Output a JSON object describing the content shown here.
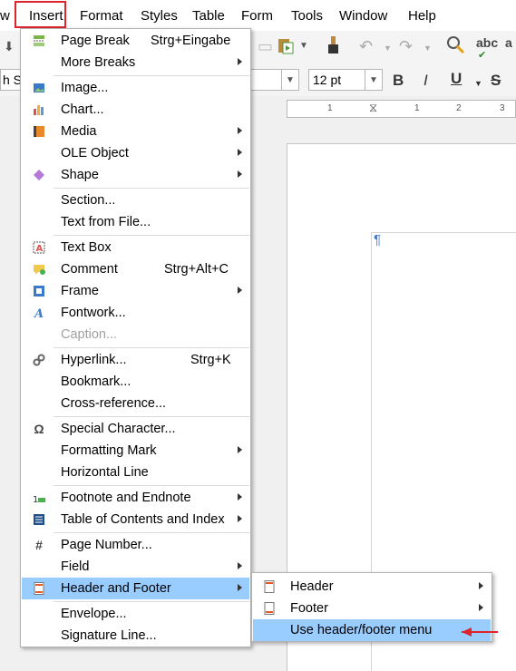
{
  "menubar": {
    "items": [
      "w",
      "Insert",
      "Format",
      "Styles",
      "Table",
      "Form",
      "Tools",
      "Window",
      "Help"
    ]
  },
  "toolbar": {
    "font_name_value": "h St",
    "font_size_value": "12 pt",
    "bold": "B",
    "italic": "I",
    "underline": "U",
    "strikethrough": "S",
    "spellcheck_label": "abc"
  },
  "ruler": {
    "ticks": [
      "1",
      "1",
      "2",
      "3"
    ]
  },
  "page": {
    "pilcrow": "¶"
  },
  "insert_menu": {
    "items": [
      {
        "label": "Page Break",
        "shortcut": "Strg+Eingabe",
        "icon": "page-break-icon"
      },
      {
        "label": "More Breaks",
        "submenu": true
      },
      {
        "label": "Image...",
        "icon": "image-icon"
      },
      {
        "label": "Chart...",
        "icon": "chart-icon"
      },
      {
        "label": "Media",
        "submenu": true,
        "icon": "media-icon"
      },
      {
        "label": "OLE Object",
        "submenu": true
      },
      {
        "label": "Shape",
        "submenu": true,
        "icon": "shape-icon"
      },
      {
        "label": "Section..."
      },
      {
        "label": "Text from File..."
      },
      {
        "label": "Text Box",
        "icon": "text-box-icon"
      },
      {
        "label": "Comment",
        "shortcut": "Strg+Alt+C",
        "icon": "comment-icon"
      },
      {
        "label": "Frame",
        "submenu": true,
        "icon": "frame-icon"
      },
      {
        "label": "Fontwork...",
        "icon": "fontwork-icon"
      },
      {
        "label": "Caption...",
        "disabled": true
      },
      {
        "label": "Hyperlink...",
        "shortcut": "Strg+K",
        "icon": "hyperlink-icon"
      },
      {
        "label": "Bookmark..."
      },
      {
        "label": "Cross-reference..."
      },
      {
        "label": "Special Character...",
        "icon": "omega-icon"
      },
      {
        "label": "Formatting Mark",
        "submenu": true
      },
      {
        "label": "Horizontal Line"
      },
      {
        "label": "Footnote and Endnote",
        "submenu": true,
        "icon": "footnote-icon"
      },
      {
        "label": "Table of Contents and Index",
        "submenu": true,
        "icon": "toc-icon"
      },
      {
        "label": "Page Number...",
        "icon": "hash-icon"
      },
      {
        "label": "Field",
        "submenu": true
      },
      {
        "label": "Header and Footer",
        "submenu": true,
        "icon": "header-footer-icon",
        "highlighted": true
      },
      {
        "label": "Envelope..."
      },
      {
        "label": "Signature Line..."
      }
    ]
  },
  "header_footer_submenu": {
    "items": [
      {
        "label": "Header",
        "submenu": true,
        "icon": "header-icon"
      },
      {
        "label": "Footer",
        "submenu": true,
        "icon": "footer-icon"
      },
      {
        "label": "Use header/footer menu",
        "highlighted": true
      }
    ]
  },
  "colors": {
    "highlight": "#99ccff",
    "annotation_red": "#e0242b",
    "pilcrow_blue": "#3d7fd9"
  }
}
